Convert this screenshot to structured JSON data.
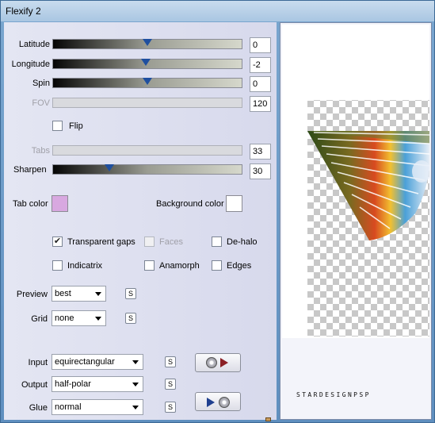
{
  "window": {
    "title": "Flexify 2"
  },
  "sliders": [
    {
      "label": "Latitude",
      "value": "0",
      "level": 0.5,
      "enabled": true
    },
    {
      "label": "Longitude",
      "value": "-2",
      "level": 0.49,
      "enabled": true
    },
    {
      "label": "Spin",
      "value": "0",
      "level": 0.5,
      "enabled": true
    },
    {
      "label": "FOV",
      "value": "120",
      "enabled": false
    },
    {
      "label": "Tabs",
      "value": "33",
      "enabled": false
    },
    {
      "label": "Sharpen",
      "value": "30",
      "level": 0.3,
      "enabled": true
    }
  ],
  "flip": {
    "label": "Flip",
    "checked": false
  },
  "tab_color": {
    "label": "Tab color",
    "color": "#d8a8e0"
  },
  "background_color": {
    "label": "Background color",
    "color": "#ffffff"
  },
  "options": {
    "transparent_gaps": {
      "label": "Transparent gaps",
      "checked": true
    },
    "faces": {
      "label": "Faces",
      "checked": false,
      "enabled": false
    },
    "de_halo": {
      "label": "De-halo",
      "checked": false
    },
    "indicatrix": {
      "label": "Indicatrix",
      "checked": false
    },
    "anamorph": {
      "label": "Anamorph",
      "checked": false
    },
    "edges": {
      "label": "Edges",
      "checked": false
    }
  },
  "preview": {
    "label": "Preview",
    "value": "best"
  },
  "grid": {
    "label": "Grid",
    "value": "none"
  },
  "input": {
    "label": "Input",
    "value": "equirectangular"
  },
  "output": {
    "label": "Output",
    "value": "half-polar"
  },
  "glue": {
    "label": "Glue",
    "value": "normal"
  },
  "save_button_glyph": "S",
  "colors": {
    "slider_thumb": "#1f4f9f",
    "titlebar": "#b9d1ea",
    "panel": "#dcdeee"
  }
}
